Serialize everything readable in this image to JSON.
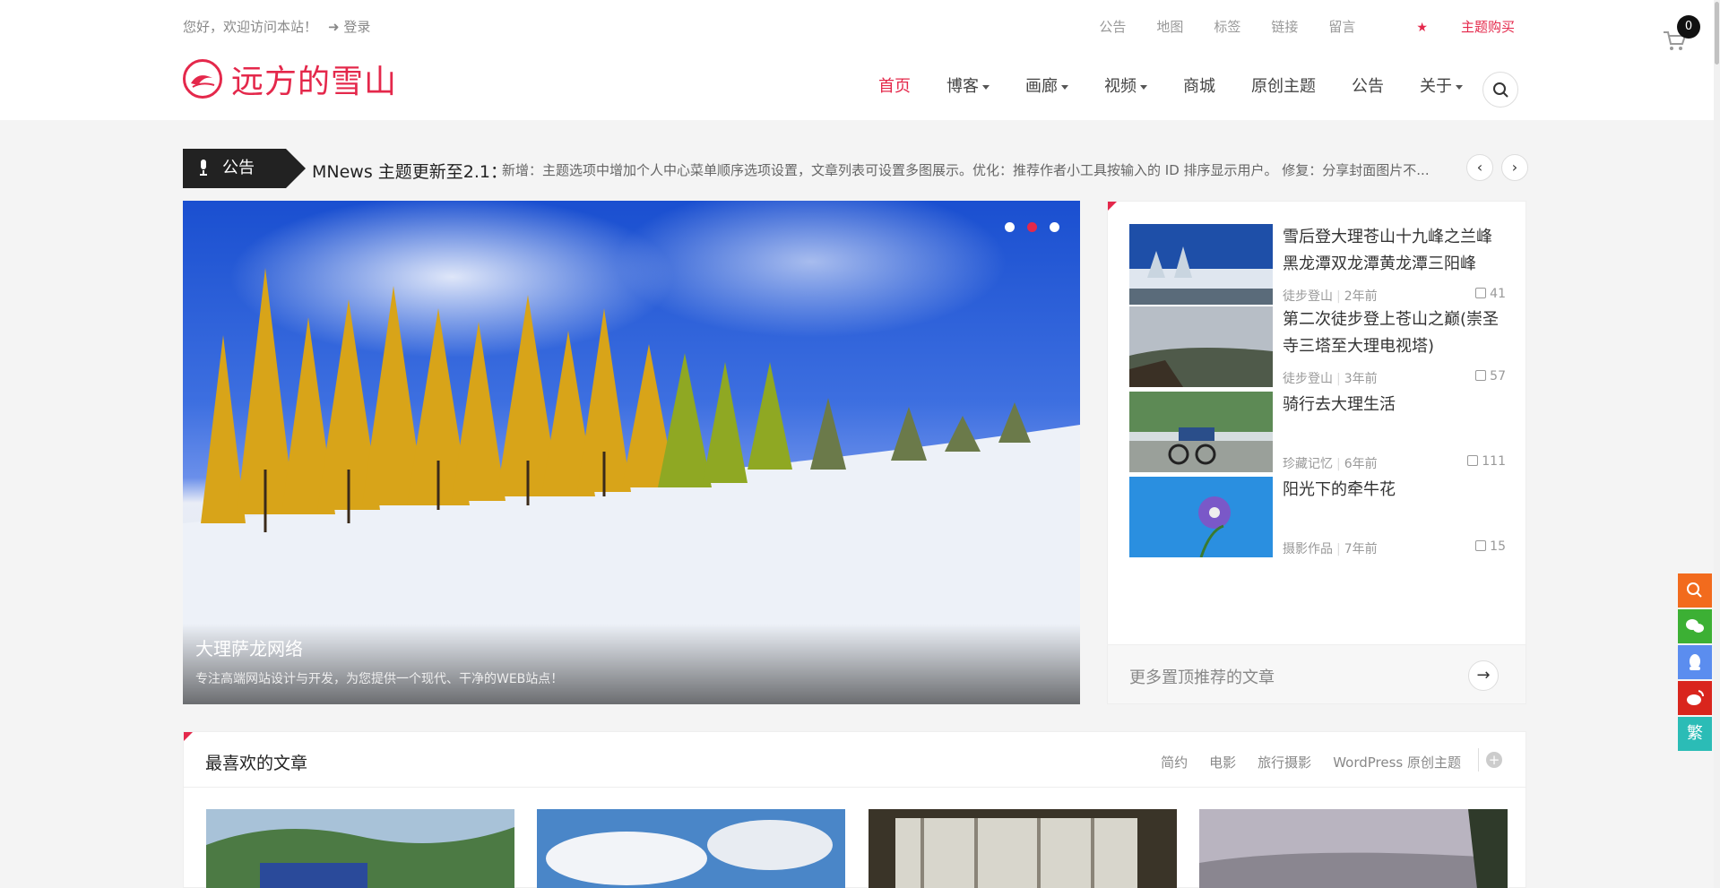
{
  "topbar": {
    "welcome": "您好，欢迎访问本站！",
    "login": "登录",
    "links": [
      "公告",
      "地图",
      "标签",
      "链接",
      "留言"
    ],
    "buy": "主题购买",
    "cart_count": "0"
  },
  "logo": {
    "text": "远方的雪山"
  },
  "nav": {
    "items": [
      {
        "label": "首页",
        "active": true,
        "dropdown": false
      },
      {
        "label": "博客",
        "dropdown": true
      },
      {
        "label": "画廊",
        "dropdown": true
      },
      {
        "label": "视频",
        "dropdown": true
      },
      {
        "label": "商城",
        "dropdown": false
      },
      {
        "label": "原创主题",
        "dropdown": false
      },
      {
        "label": "公告",
        "dropdown": false
      },
      {
        "label": "关于",
        "dropdown": true
      }
    ]
  },
  "notice": {
    "tag": "公告",
    "title": "MNews 主题更新至2.1：",
    "text": "新增：主题选项中增加个人中心菜单顺序选项设置，文章列表可设置多图展示。优化：推荐作者小工具按输入的 ID 排序显示用户。 修复：分享封面图片不..."
  },
  "hero": {
    "title": "大理萨龙网络",
    "subtitle": "专注高端网站设计与开发，为您提供一个现代、干净的WEB站点！",
    "active_slide": 2,
    "slide_count": 3
  },
  "sticky_posts": [
    {
      "title": "雪后登大理苍山十九峰之兰峰黑龙潭双龙潭黄龙潭三阳峰",
      "category": "徒步登山",
      "time": "2年前",
      "likes": "41"
    },
    {
      "title": "第二次徒步登上苍山之巅(崇圣寺三塔至大理电视塔)",
      "category": "徒步登山",
      "time": "3年前",
      "likes": "57"
    },
    {
      "title": "骑行去大理生活",
      "category": "珍藏记忆",
      "time": "6年前",
      "likes": "111"
    },
    {
      "title": "阳光下的牵牛花",
      "category": "摄影作品",
      "time": "7年前",
      "likes": "15"
    }
  ],
  "more_sticky": "更多置顶推荐的文章",
  "favorites": {
    "title": "最喜欢的文章",
    "tabs": [
      "简约",
      "电影",
      "旅行摄影",
      "WordPress 原创主题"
    ]
  },
  "float_bar": {
    "colors": [
      "#f26b1d",
      "#3cb034",
      "#5b8def",
      "#d9251d",
      "#2bbcb6"
    ],
    "icons": [
      "search-icon",
      "wechat-icon",
      "qq-icon",
      "weibo-icon",
      "traditional-chinese-icon"
    ],
    "trad_label": "繁"
  },
  "colors": {
    "accent": "#e4284b"
  }
}
